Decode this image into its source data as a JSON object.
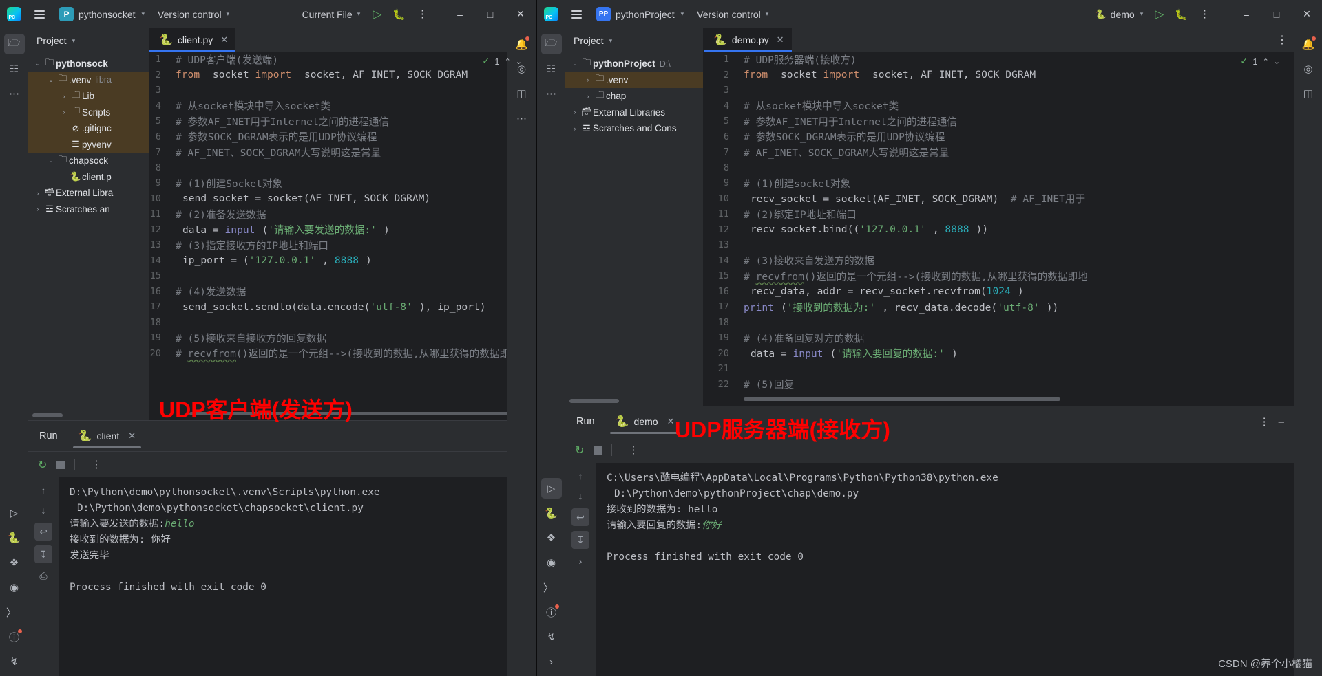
{
  "left_window": {
    "titlebar": {
      "app_icon": "pycharm-logo-icon",
      "menu_icon": "hamburger-menu-icon",
      "project_badge": "P",
      "project_name": "pythonsocket",
      "version_control": "Version control",
      "run_config": "Current File",
      "run_icon": "run-icon",
      "debug_icon": "debug-icon",
      "more_icon": "more-options-icon",
      "minimize": "–",
      "maximize": "□",
      "close": "✕"
    },
    "project_tool": {
      "title": "Project",
      "tree": [
        {
          "indent": 0,
          "arrow": "⌄",
          "icon": "folder-icon",
          "label": "pythonsock",
          "bold": true,
          "sub": "",
          "hl": false
        },
        {
          "indent": 1,
          "arrow": "⌄",
          "icon": "folder-icon",
          "label": ".venv",
          "bold": false,
          "sub": "libra",
          "hl": true
        },
        {
          "indent": 2,
          "arrow": "›",
          "icon": "folder-icon",
          "label": "Lib",
          "bold": false,
          "sub": "",
          "hl": true
        },
        {
          "indent": 2,
          "arrow": "›",
          "icon": "folder-icon",
          "label": "Scripts",
          "bold": false,
          "sub": "",
          "hl": true
        },
        {
          "indent": 2,
          "arrow": "",
          "icon": "gitignore-icon",
          "label": ".gitignc",
          "bold": false,
          "sub": "",
          "hl": true
        },
        {
          "indent": 2,
          "arrow": "",
          "icon": "config-icon",
          "label": "pyvenv",
          "bold": false,
          "sub": "",
          "hl": true
        },
        {
          "indent": 1,
          "arrow": "⌄",
          "icon": "folder-icon",
          "label": "chapsock",
          "bold": false,
          "sub": "",
          "hl": false
        },
        {
          "indent": 2,
          "arrow": "",
          "icon": "python-file-icon",
          "label": "client.p",
          "bold": false,
          "sub": "",
          "hl": false
        },
        {
          "indent": 0,
          "arrow": "›",
          "icon": "library-icon",
          "label": "External Libra",
          "bold": false,
          "sub": "",
          "hl": false
        },
        {
          "indent": 0,
          "arrow": "›",
          "icon": "scratches-icon",
          "label": "Scratches an",
          "bold": false,
          "sub": "",
          "hl": false
        }
      ]
    },
    "editor": {
      "tab_name": "client.py",
      "tab_icon": "python-file-icon",
      "tab_close": "✕",
      "more_icon": "editor-options-icon",
      "inspection_ok": "✓",
      "inspection_count": "1",
      "up_arrow": "⌃",
      "down_arrow": "⌄",
      "lines": [
        {
          "n": 1,
          "tokens": [
            {
              "t": "# UDP客户端(发送端)",
              "c": "cm"
            }
          ]
        },
        {
          "n": 2,
          "tokens": [
            {
              "t": "from",
              "c": "kw"
            },
            {
              "t": " socket ",
              "c": "ln"
            },
            {
              "t": "import",
              "c": "kw"
            },
            {
              "t": " socket, AF_INET, SOCK_DGRAM",
              "c": "ln"
            }
          ]
        },
        {
          "n": 3,
          "tokens": []
        },
        {
          "n": 4,
          "tokens": [
            {
              "t": "# 从socket模块中导入socket类",
              "c": "cm"
            }
          ]
        },
        {
          "n": 5,
          "tokens": [
            {
              "t": "# 参数AF_INET用于Internet之间的进程通信",
              "c": "cm"
            }
          ]
        },
        {
          "n": 6,
          "tokens": [
            {
              "t": "# 参数SOCK_DGRAM表示的是用UDP协议编程",
              "c": "cm"
            }
          ]
        },
        {
          "n": 7,
          "tokens": [
            {
              "t": "# AF_INET、SOCK_DGRAM大写说明这是常量",
              "c": "cm"
            }
          ]
        },
        {
          "n": 8,
          "tokens": []
        },
        {
          "n": 9,
          "tokens": [
            {
              "t": "# (1)创建Socket对象",
              "c": "cm"
            }
          ]
        },
        {
          "n": 10,
          "tokens": [
            {
              "t": "send_socket = socket(AF_INET, SOCK_DGRAM)",
              "c": "ln"
            }
          ]
        },
        {
          "n": 11,
          "tokens": [
            {
              "t": "# (2)准备发送数据",
              "c": "cm"
            }
          ]
        },
        {
          "n": 12,
          "tokens": [
            {
              "t": "data = ",
              "c": "ln"
            },
            {
              "t": "input",
              "c": "bi"
            },
            {
              "t": "(",
              "c": "ln"
            },
            {
              "t": "'请输入要发送的数据:'",
              "c": "str"
            },
            {
              "t": ")",
              "c": "ln"
            }
          ]
        },
        {
          "n": 13,
          "tokens": [
            {
              "t": "# (3)指定接收方的IP地址和端口",
              "c": "cm"
            }
          ]
        },
        {
          "n": 14,
          "tokens": [
            {
              "t": "ip_port = (",
              "c": "ln"
            },
            {
              "t": "'127.0.0.1'",
              "c": "str"
            },
            {
              "t": ", ",
              "c": "ln"
            },
            {
              "t": "8888",
              "c": "num"
            },
            {
              "t": ")",
              "c": "ln"
            }
          ]
        },
        {
          "n": 15,
          "tokens": []
        },
        {
          "n": 16,
          "tokens": [
            {
              "t": "# (4)发送数据",
              "c": "cm"
            }
          ]
        },
        {
          "n": 17,
          "tokens": [
            {
              "t": "send_socket.sendto(data.encode(",
              "c": "ln"
            },
            {
              "t": "'utf-8'",
              "c": "str"
            },
            {
              "t": "), ip_port)",
              "c": "ln"
            }
          ]
        },
        {
          "n": 18,
          "tokens": []
        },
        {
          "n": 19,
          "tokens": [
            {
              "t": "# (5)接收来自接收方的回复数据",
              "c": "cm"
            }
          ]
        },
        {
          "n": 20,
          "tokens": [
            {
              "t": "# ",
              "c": "cm"
            },
            {
              "t": "recvfrom",
              "c": "cm ul"
            },
            {
              "t": "()返回的是一个元组-->(接收到的数据,从哪里获得的数据即地址)",
              "c": "cm"
            }
          ]
        }
      ]
    },
    "run_panel": {
      "title": "Run",
      "tab_name": "client",
      "tab_icon": "python-file-icon",
      "tab_close": "✕",
      "rerun_icon": "rerun-icon",
      "stop_icon": "stop-icon",
      "more_icon": "console-options-icon",
      "gutter_icons": [
        "up-arrow-icon",
        "down-arrow-icon",
        "soft-wrap-icon",
        "scroll-to-end-icon",
        "print-icon"
      ],
      "console_lines": [
        {
          "text": "D:\\Python\\demo\\pythonsocket\\.venv\\Scripts\\python.exe",
          "style": "plain",
          "indent": false
        },
        {
          "text": "D:\\Python\\demo\\pythonsocket\\chapsocket\\client.py",
          "style": "plain",
          "indent": true
        },
        {
          "text": "请输入要发送的数据:",
          "style": "plain",
          "indent": false,
          "suffix": "hello",
          "suffix_style": "greeni"
        },
        {
          "text": "接收到的数据为:  你好",
          "style": "plain",
          "indent": false
        },
        {
          "text": "发送完毕",
          "style": "plain",
          "indent": false
        },
        {
          "text": "",
          "style": "plain",
          "indent": false
        },
        {
          "text": "Process finished with exit code 0",
          "style": "plain",
          "indent": false
        }
      ]
    },
    "overlay_label": "UDP客户端(发送方)"
  },
  "right_window": {
    "titlebar": {
      "app_icon": "pycharm-logo-icon",
      "menu_icon": "hamburger-menu-icon",
      "project_badge": "PP",
      "project_name": "pythonProject",
      "version_control": "Version control",
      "run_config": "demo",
      "run_config_icon": "python-file-icon",
      "run_icon": "run-icon",
      "debug_icon": "debug-icon",
      "more_icon": "more-options-icon",
      "minimize": "–",
      "maximize": "□",
      "close": "✕"
    },
    "project_tool": {
      "title": "Project",
      "tree": [
        {
          "indent": 0,
          "arrow": "⌄",
          "icon": "folder-icon",
          "label": "pythonProject",
          "bold": true,
          "sub": "D:\\",
          "hl": false
        },
        {
          "indent": 1,
          "arrow": "›",
          "icon": "folder-icon",
          "label": ".venv",
          "bold": false,
          "sub": "",
          "hl": true
        },
        {
          "indent": 1,
          "arrow": "›",
          "icon": "folder-icon",
          "label": "chap",
          "bold": false,
          "sub": "",
          "hl": false
        },
        {
          "indent": 0,
          "arrow": "›",
          "icon": "library-icon",
          "label": "External Libraries",
          "bold": false,
          "sub": "",
          "hl": false
        },
        {
          "indent": 0,
          "arrow": "›",
          "icon": "scratches-icon",
          "label": "Scratches and Cons",
          "bold": false,
          "sub": "",
          "hl": false
        }
      ]
    },
    "editor": {
      "tab_name": "demo.py",
      "tab_icon": "python-file-icon",
      "tab_close": "✕",
      "more_icon": "editor-options-icon",
      "inspection_ok": "✓",
      "inspection_count": "1",
      "up_arrow": "⌃",
      "down_arrow": "⌄",
      "lines": [
        {
          "n": 1,
          "tokens": [
            {
              "t": "# UDP服务器端(接收方)",
              "c": "cm"
            }
          ]
        },
        {
          "n": 2,
          "tokens": [
            {
              "t": "from",
              "c": "kw"
            },
            {
              "t": " socket ",
              "c": "ln"
            },
            {
              "t": "import",
              "c": "kw"
            },
            {
              "t": " socket, AF_INET, SOCK_DGRAM",
              "c": "ln"
            }
          ]
        },
        {
          "n": 3,
          "tokens": []
        },
        {
          "n": 4,
          "tokens": [
            {
              "t": "# 从socket模块中导入socket类",
              "c": "cm"
            }
          ]
        },
        {
          "n": 5,
          "tokens": [
            {
              "t": "# 参数AF_INET用于Internet之间的进程通信",
              "c": "cm"
            }
          ]
        },
        {
          "n": 6,
          "tokens": [
            {
              "t": "# 参数SOCK_DGRAM表示的是用UDP协议编程",
              "c": "cm"
            }
          ]
        },
        {
          "n": 7,
          "tokens": [
            {
              "t": "# AF_INET、SOCK_DGRAM大写说明这是常量",
              "c": "cm"
            }
          ]
        },
        {
          "n": 8,
          "tokens": []
        },
        {
          "n": 9,
          "tokens": [
            {
              "t": "# (1)创建socket对象",
              "c": "cm"
            }
          ]
        },
        {
          "n": 10,
          "tokens": [
            {
              "t": "recv_socket = socket(AF_INET, SOCK_DGRAM)  ",
              "c": "ln"
            },
            {
              "t": "# AF_INET用于",
              "c": "cm"
            }
          ]
        },
        {
          "n": 11,
          "tokens": [
            {
              "t": "# (2)绑定IP地址和端口",
              "c": "cm"
            }
          ]
        },
        {
          "n": 12,
          "tokens": [
            {
              "t": "recv_socket.bind((",
              "c": "ln"
            },
            {
              "t": "'127.0.0.1'",
              "c": "str"
            },
            {
              "t": ", ",
              "c": "ln"
            },
            {
              "t": "8888",
              "c": "num"
            },
            {
              "t": "))",
              "c": "ln"
            }
          ]
        },
        {
          "n": 13,
          "tokens": []
        },
        {
          "n": 14,
          "tokens": [
            {
              "t": "# (3)接收来自发送方的数据",
              "c": "cm"
            }
          ]
        },
        {
          "n": 15,
          "tokens": [
            {
              "t": "# ",
              "c": "cm"
            },
            {
              "t": "recvfrom",
              "c": "cm ul"
            },
            {
              "t": "()返回的是一个元组-->(接收到的数据,从哪里获得的数据即地",
              "c": "cm"
            }
          ]
        },
        {
          "n": 16,
          "tokens": [
            {
              "t": "recv_data, addr = recv_socket.recvfrom(",
              "c": "ln"
            },
            {
              "t": "1024",
              "c": "num"
            },
            {
              "t": ")",
              "c": "ln"
            }
          ]
        },
        {
          "n": 17,
          "tokens": [
            {
              "t": "print",
              "c": "bi"
            },
            {
              "t": "(",
              "c": "ln"
            },
            {
              "t": "'接收到的数据为:'",
              "c": "str"
            },
            {
              "t": ", recv_data.decode(",
              "c": "ln"
            },
            {
              "t": "'utf-8'",
              "c": "str"
            },
            {
              "t": "))",
              "c": "ln"
            }
          ]
        },
        {
          "n": 18,
          "tokens": []
        },
        {
          "n": 19,
          "tokens": [
            {
              "t": "# (4)准备回复对方的数据",
              "c": "cm"
            }
          ]
        },
        {
          "n": 20,
          "tokens": [
            {
              "t": "data = ",
              "c": "ln"
            },
            {
              "t": "input",
              "c": "bi"
            },
            {
              "t": "(",
              "c": "ln"
            },
            {
              "t": "'请输入要回复的数据:'",
              "c": "str"
            },
            {
              "t": ")",
              "c": "ln"
            }
          ]
        },
        {
          "n": 21,
          "tokens": []
        },
        {
          "n": 22,
          "tokens": [
            {
              "t": "# (5)回复",
              "c": "cm"
            }
          ]
        }
      ]
    },
    "run_panel": {
      "title": "Run",
      "tab_name": "demo",
      "tab_icon": "python-file-icon",
      "tab_close": "✕",
      "rerun_icon": "rerun-icon",
      "stop_icon": "stop-icon",
      "more_icon": "console-options-icon",
      "minimize_icon": "–",
      "gutter_icons": [
        "up-arrow-icon",
        "down-arrow-icon",
        "soft-wrap-icon",
        "scroll-to-end-icon",
        "expand-icon"
      ],
      "console_lines": [
        {
          "text": "C:\\Users\\酷电编程\\AppData\\Local\\Programs\\Python\\Python38\\python.exe",
          "style": "plain",
          "indent": false
        },
        {
          "text": "D:\\Python\\demo\\pythonProject\\chap\\demo.py",
          "style": "plain",
          "indent": true
        },
        {
          "text": "接收到的数据为:  hello",
          "style": "plain",
          "indent": false
        },
        {
          "text": "请输入要回复的数据:",
          "style": "plain",
          "indent": false,
          "suffix": "你好",
          "suffix_style": "greeni"
        },
        {
          "text": "",
          "style": "plain",
          "indent": false
        },
        {
          "text": "Process finished with exit code 0",
          "style": "plain",
          "indent": false
        }
      ]
    },
    "overlay_label": "UDP服务器端(接收方)"
  },
  "watermark": "CSDN @养个小橘猫",
  "colors": {
    "accent_blue": "#3574f0",
    "overlay_red": "#ff0000",
    "comment_gray": "#7a7e85",
    "string_green": "#6aab73",
    "keyword_orange": "#cf8e6d",
    "number_cyan": "#2aacb8",
    "bg_editor": "#1e1f22",
    "bg_panel": "#2b2d30",
    "tree_highlight": "#4a3b23"
  }
}
